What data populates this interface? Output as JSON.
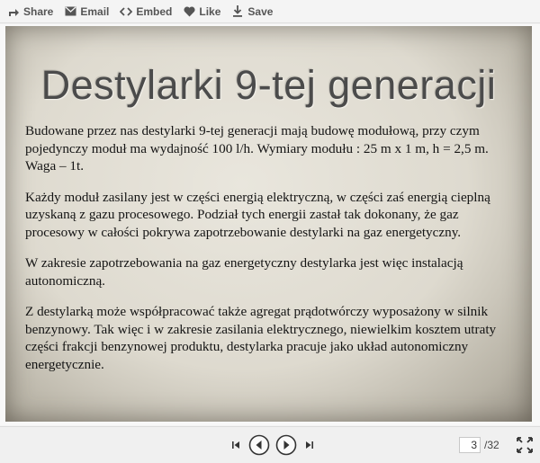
{
  "toolbar": {
    "share_label": "Share",
    "email_label": "Email",
    "embed_label": "Embed",
    "like_label": "Like",
    "save_label": "Save",
    "icons": [
      "share-icon",
      "email-icon",
      "embed-icon",
      "heart-icon",
      "download-icon"
    ]
  },
  "slide": {
    "title": "Destylarki 9-tej generacji",
    "paragraphs": [
      "Budowane przez nas destylarki 9-tej generacji mają budowę modułową, przy czym pojedynczy moduł ma wydajność 100 l/h. Wymiary modułu : 25 m x 1 m, h = 2,5 m. Waga – 1t.",
      "Każdy moduł zasilany jest w części energią elektryczną, w części zaś energią cieplną uzyskaną z gazu procesowego. Podział tych energii zastał tak dokonany, że gaz procesowy w całości pokrywa zapotrzebowanie destylarki na gaz energetyczny.",
      "W zakresie zapotrzebowania na gaz energetyczny destylarka jest więc instalacją autonomiczną.",
      "Z destylarką może współpracować także agregat prądotwórczy wyposażony w silnik benzynowy. Tak więc i w zakresie zasilania elektrycznego, niewielkim kosztem utraty części frakcji benzynowej produktu, destylarka pracuje jako układ autonomiczny energetycznie."
    ]
  },
  "navigation": {
    "current_page": "3",
    "total_pages": "/32",
    "icons": [
      "first-page-icon",
      "previous-icon",
      "next-icon",
      "last-page-icon",
      "fullscreen-icon"
    ]
  },
  "colors": {
    "slide_background": "#dedacf",
    "title_text": "#4b4b4b",
    "body_text": "#141414"
  }
}
